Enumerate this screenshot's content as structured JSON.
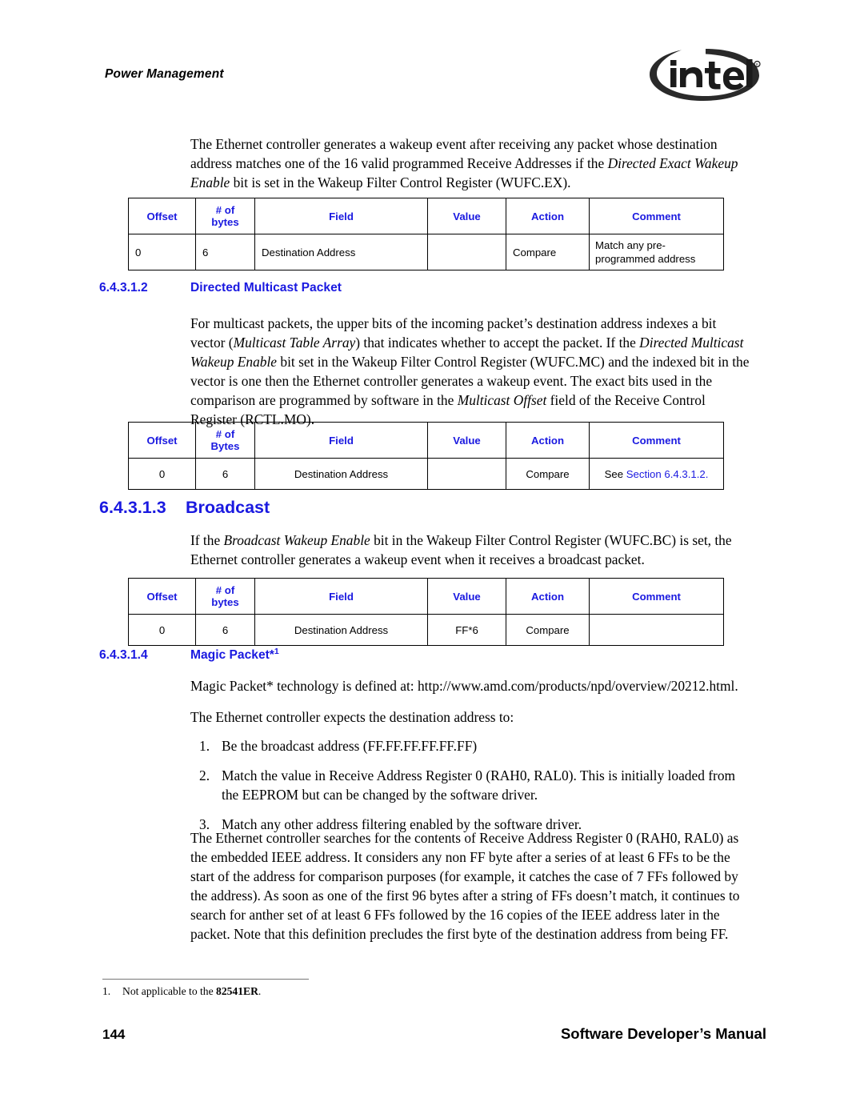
{
  "header": {
    "running_head": "Power Management",
    "logo_alt": "intel-logo",
    "logo_wordmark": "intel",
    "logo_registered": "®"
  },
  "intro_paragraph": {
    "segments": [
      {
        "text": "The Ethernet controller generates a wakeup event after receiving any packet whose destination address matches one of the 16 valid programmed Receive Addresses if the ",
        "style": "normal"
      },
      {
        "text": "Directed Exact Wakeup Enable",
        "style": "italic"
      },
      {
        "text": " bit is set in the Wakeup Filter Control Register (WUFC.EX).",
        "style": "normal"
      }
    ],
    "plain": "The Ethernet controller generates a wakeup event after receiving any packet whose destination address matches one of the 16 valid programmed Receive Addresses if the Directed Exact Wakeup Enable bit is set in the Wakeup Filter Control Register (WUFC.EX)."
  },
  "table_directed_exact": {
    "headers": [
      "Offset",
      "# of bytes",
      "Field",
      "Value",
      "Action",
      "Comment"
    ],
    "header_lines": [
      [
        "Offset"
      ],
      [
        "# of",
        "bytes"
      ],
      [
        "Field"
      ],
      [
        "Value"
      ],
      [
        "Action"
      ],
      [
        "Comment"
      ]
    ],
    "rows": [
      {
        "offset": "0",
        "bytes": "6",
        "field": "Destination Address",
        "value": "",
        "action": "Compare",
        "comment": "Match any pre-programmed address"
      }
    ]
  },
  "section_multicast": {
    "number": "6.4.3.1.2",
    "title": "Directed Multicast Packet",
    "paragraph": {
      "segments": [
        {
          "text": "For multicast packets, the upper bits of the incoming packet’s destination address indexes a bit vector (",
          "style": "normal"
        },
        {
          "text": "Multicast Table Array",
          "style": "italic"
        },
        {
          "text": ") that indicates whether to accept the packet. If the ",
          "style": "normal"
        },
        {
          "text": "Directed Multicast Wakeup Enable",
          "style": "italic"
        },
        {
          "text": " bit set in the Wakeup Filter Control Register (WUFC.MC) and the indexed bit in the vector is one then the Ethernet controller generates a wakeup event. The exact bits used in the comparison are programmed by software in the ",
          "style": "normal"
        },
        {
          "text": "Multicast Offset",
          "style": "italic"
        },
        {
          "text": " field of the Receive Control Register (RCTL.MO).",
          "style": "normal"
        }
      ],
      "plain": "For multicast packets, the upper bits of the incoming packet’s destination address indexes a bit vector (Multicast Table Array) that indicates whether to accept the packet. If the Directed Multicast Wakeup Enable bit set in the Wakeup Filter Control Register (WUFC.MC) and the indexed bit in the vector is one then the Ethernet controller generates a wakeup event. The exact bits used in the comparison are programmed by software in the Multicast Offset field of the Receive Control Register (RCTL.MO)."
    },
    "table": {
      "headers": [
        "Offset",
        "# of Bytes",
        "Field",
        "Value",
        "Action",
        "Comment"
      ],
      "header_lines": [
        [
          "Offset"
        ],
        [
          "# of",
          "Bytes"
        ],
        [
          "Field"
        ],
        [
          "Value"
        ],
        [
          "Action"
        ],
        [
          "Comment"
        ]
      ],
      "rows": [
        {
          "offset": "0",
          "bytes": "6",
          "field": "Destination Address",
          "value": "",
          "action": "Compare",
          "comment_prefix": "See ",
          "comment_link": "Section 6.4.3.1.2."
        }
      ]
    }
  },
  "section_broadcast": {
    "number": "6.4.3.1.3",
    "title": "Broadcast",
    "paragraph": {
      "segments": [
        {
          "text": "If the ",
          "style": "normal"
        },
        {
          "text": "Broadcast Wakeup Enable",
          "style": "italic"
        },
        {
          "text": " bit in the Wakeup Filter Control Register (WUFC.BC) is set, the Ethernet controller generates a wakeup event when it receives a broadcast packet.",
          "style": "normal"
        }
      ],
      "plain": "If the Broadcast Wakeup Enable bit in the Wakeup Filter Control Register (WUFC.BC) is set, the Ethernet controller generates a wakeup event when it receives a broadcast packet."
    },
    "table": {
      "headers": [
        "Offset",
        "# of bytes",
        "Field",
        "Value",
        "Action",
        "Comment"
      ],
      "header_lines": [
        [
          "Offset"
        ],
        [
          "# of",
          "bytes"
        ],
        [
          "Field"
        ],
        [
          "Value"
        ],
        [
          "Action"
        ],
        [
          "Comment"
        ]
      ],
      "rows": [
        {
          "offset": "0",
          "bytes": "6",
          "field": "Destination Address",
          "value": "FF*6",
          "action": "Compare",
          "comment": ""
        }
      ]
    }
  },
  "section_magic": {
    "number": "6.4.3.1.4",
    "title": "Magic Packet*",
    "footnote_marker": "1",
    "url_paragraph": "Magic Packet* technology is defined at: http://www.amd.com/products/npd/overview/20212.html.",
    "expects_lead": "The Ethernet controller expects the destination address to:",
    "list": [
      {
        "marker": "1.",
        "text": "Be the broadcast address (FF.FF.FF.FF.FF.FF)"
      },
      {
        "marker": "2.",
        "text": "Match the value in Receive Address Register 0 (RAH0, RAL0). This is initially loaded from the EEPROM but can be changed by the software driver."
      },
      {
        "marker": "3.",
        "text": "Match any other address filtering enabled by the software driver."
      }
    ],
    "closing_paragraph": "The Ethernet controller searches for the contents of Receive Address Register 0 (RAH0, RAL0) as the embedded IEEE address. It considers any non FF byte after a series of at least 6 FFs to be the start of the address for comparison purposes (for example, it catches the case of 7 FFs followed by the address). As soon as one of the first 96 bytes after a string of FFs doesn’t match, it continues to search for anther set of at least 6 FFs followed by the 16 copies of the IEEE address later in the packet. Note that this definition precludes the first byte of the destination address from being FF."
  },
  "footnote": {
    "marker": "1.",
    "prefix": "Not applicable to the ",
    "bold": "82541ER",
    "suffix": "."
  },
  "footer": {
    "page_number": "144",
    "manual_title": "Software Developer’s Manual"
  },
  "colors": {
    "heading_blue": "#1a19e0",
    "link_blue": "#1a19e0",
    "text_black": "#000000",
    "page_background": "#ffffff",
    "rule_gray": "#777777"
  }
}
